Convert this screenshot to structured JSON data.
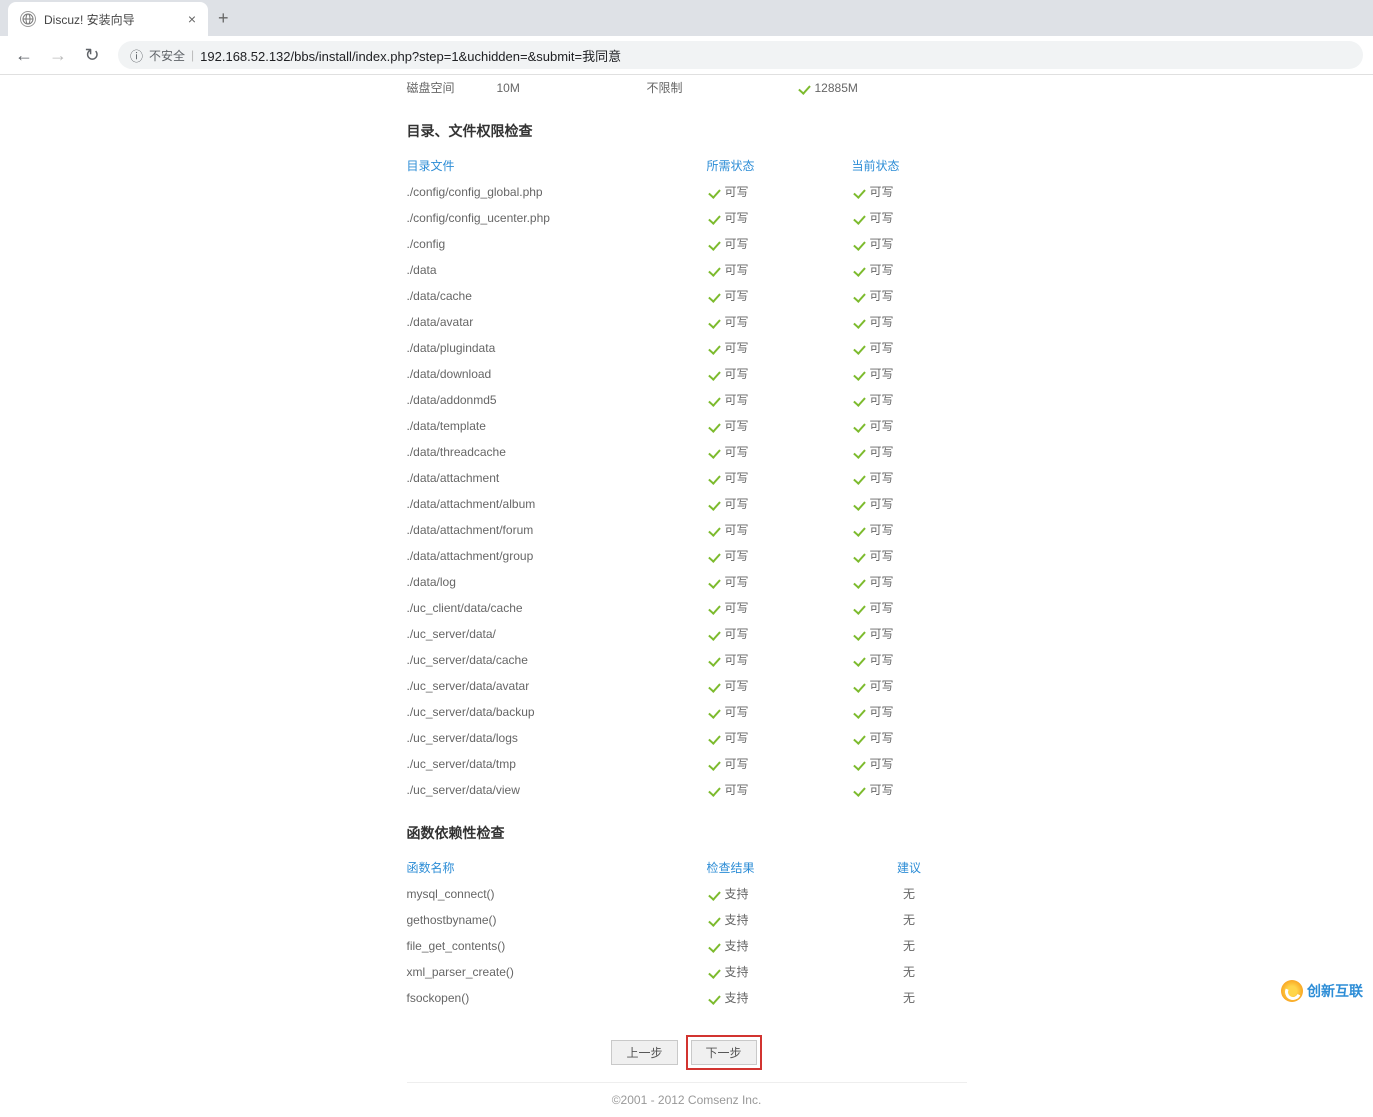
{
  "browser": {
    "tab_title": "Discuz! 安装向导",
    "address_security": "不安全",
    "address_url": "192.168.52.132/bbs/install/index.php?step=1&uchidden=&submit=我同意"
  },
  "disk": {
    "label": "磁盘空间",
    "required": "10M",
    "limit": "不限制",
    "current": "12885M"
  },
  "perm": {
    "title": "目录、文件权限检查",
    "headers": {
      "name": "目录文件",
      "required": "所需状态",
      "current": "当前状态"
    },
    "writable": "可写",
    "items": [
      "./config/config_global.php",
      "./config/config_ucenter.php",
      "./config",
      "./data",
      "./data/cache",
      "./data/avatar",
      "./data/plugindata",
      "./data/download",
      "./data/addonmd5",
      "./data/template",
      "./data/threadcache",
      "./data/attachment",
      "./data/attachment/album",
      "./data/attachment/forum",
      "./data/attachment/group",
      "./data/log",
      "./uc_client/data/cache",
      "./uc_server/data/",
      "./uc_server/data/cache",
      "./uc_server/data/avatar",
      "./uc_server/data/backup",
      "./uc_server/data/logs",
      "./uc_server/data/tmp",
      "./uc_server/data/view"
    ]
  },
  "func": {
    "title": "函数依赖性检查",
    "headers": {
      "name": "函数名称",
      "result": "检查结果",
      "suggest": "建议"
    },
    "supported": "支持",
    "none": "无",
    "items": [
      "mysql_connect()",
      "gethostbyname()",
      "file_get_contents()",
      "xml_parser_create()",
      "fsockopen()"
    ]
  },
  "buttons": {
    "prev": "上一步",
    "next": "下一步"
  },
  "footer": "©2001 - 2012 Comsenz Inc.",
  "watermark": "创新互联"
}
